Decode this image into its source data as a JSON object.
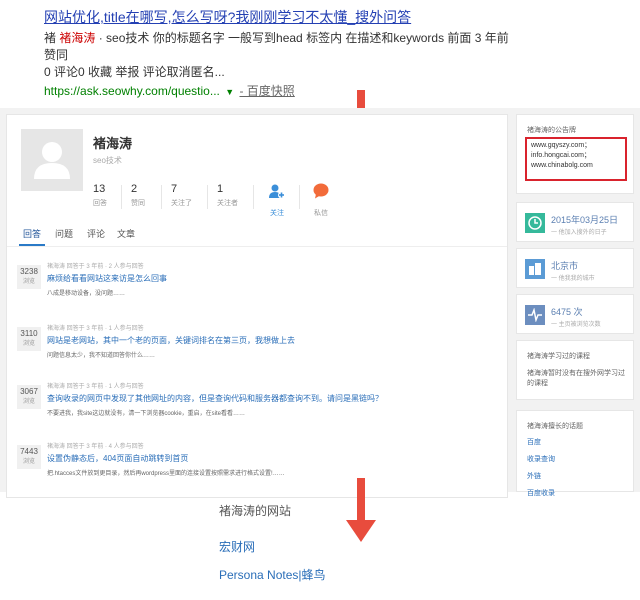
{
  "search_result": {
    "title": "网站优化,title在哪写,怎么写呀?我刚刚学习不太懂_搜外问答",
    "abstract_line1_pre": "褚 ",
    "abstract_highlight": "褚海涛",
    "abstract_line1_post": " · seo技术 你的标题名字 一般写到head 标签内 在描述和keywords 前面 3 年前 赞同",
    "abstract_line2": "0 评论0 收藏 举报 评论取消匿名...",
    "url": "https://ask.seowhy.com/questio...",
    "url_arrow": "▼",
    "snapshot": "- 百度快照"
  },
  "profile": {
    "name": "褚海涛",
    "tag": "seo技术",
    "stats": [
      {
        "num": "13",
        "label": "回答"
      },
      {
        "num": "2",
        "label": "赞同"
      },
      {
        "num": "7",
        "label": "关注了"
      },
      {
        "num": "1",
        "label": "关注者"
      }
    ],
    "actions": [
      {
        "label": "关注",
        "icon": "follow-icon"
      },
      {
        "label": "私信",
        "icon": "message-icon"
      }
    ]
  },
  "tabs": [
    "回答",
    "问题",
    "评论",
    "文章"
  ],
  "questions": [
    {
      "count": "3238",
      "count_label": "浏览",
      "meta": "褚海涛 回答于 3 年前 · 2 人参与回答",
      "title": "麻烦给看看网站这来访是怎么回事",
      "excerpt": "八成是移动设备，没问题……"
    },
    {
      "count": "3110",
      "count_label": "浏览",
      "meta": "褚海涛 回答于 3 年前 · 1 人参与回答",
      "title": "网站是老网站，其中一个老的页面，关键词排名在第三页，我想做上去",
      "excerpt": "问题信息太少，我不知道回答你什么……"
    },
    {
      "count": "3067",
      "count_label": "浏览",
      "meta": "褚海涛 回答于 3 年前 · 1 人参与回答",
      "title": "查询收录的网页中发现了其他网址的内容，但是查询代码和服务器都查询不到。请问是黑链吗？",
      "excerpt": "不要进我，我site这边就没有，清一下浏览器cookie，重启，在site看看……"
    },
    {
      "count": "7443",
      "count_label": "浏览",
      "meta": "褚海涛 回答于 3 年前 · 4 人参与回答",
      "title": "设置伪静态后，404页面自动跳转到首页",
      "excerpt": "把.htacces文件放到更目录，然后再wordpress里面的连接设置按照需求进行格式设置!……"
    }
  ],
  "sidebar": {
    "announce_title": "褚海涛的公告牌",
    "announce_lines": [
      "www.gqyszy.com；",
      "info.hongcai.com；",
      "www.chinabolg.com"
    ],
    "joined_value": "2015年03月25日",
    "joined_sub": "一 他加入搜外的日子",
    "city_value": "北京市",
    "city_sub": "一 他我我的城市",
    "visits_value": "6475 次",
    "visits_sub": "一 主页被浏览次数",
    "courses_title": "褚海涛学习过的课程",
    "courses_text": "褚海涛暂时没有在搜外网学习过的课程",
    "topics_title": "褚海涛擅长的话题",
    "topics": [
      "百度",
      "收录查询",
      "外链",
      "百度收录"
    ]
  },
  "bottom": {
    "sites_title": "褚海涛的网站",
    "link1": "宏财网",
    "link2": "Persona Notes|蜂鸟"
  },
  "colors": {
    "arrow": "#e84c3d",
    "link": "#2a6eb8",
    "highlight_box": "#d9232d"
  }
}
